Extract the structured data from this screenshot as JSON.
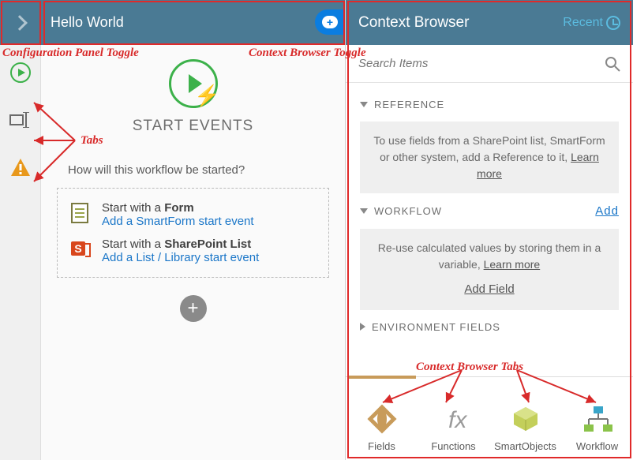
{
  "header": {
    "title": "Hello World"
  },
  "contextBrowser": {
    "title": "Context Browser",
    "recentLabel": "Recent",
    "searchPlaceholder": "Search Items",
    "reference": {
      "heading": "REFERENCE",
      "body": "To use fields from a SharePoint list, SmartForm or other system, add a Reference to it, ",
      "learn": "Learn more"
    },
    "workflow": {
      "heading": "WORKFLOW",
      "addLabel": "Add",
      "body": "Re-use calculated values by storing them in a variable, ",
      "learn": "Learn more",
      "addField": "Add Field"
    },
    "envFields": {
      "heading": "ENVIRONMENT FIELDS"
    },
    "tabs": [
      {
        "label": "Fields"
      },
      {
        "label": "Functions"
      },
      {
        "label": "SmartObjects"
      },
      {
        "label": "Workflow"
      }
    ]
  },
  "canvas": {
    "startLabel": "START EVENTS",
    "question": "How will this workflow be started?",
    "options": [
      {
        "titlePrefix": "Start with a ",
        "titleBold": "Form",
        "link": "Add a SmartForm start event"
      },
      {
        "titlePrefix": "Start with a ",
        "titleBold": "SharePoint List",
        "link": "Add a List / Library start event"
      }
    ]
  },
  "annotations": {
    "configToggle": "Configuration Panel Toggle",
    "ctxToggle": "Context Browser Toggle",
    "tabs": "Tabs",
    "ctxTabs": "Context Browser Tabs"
  }
}
